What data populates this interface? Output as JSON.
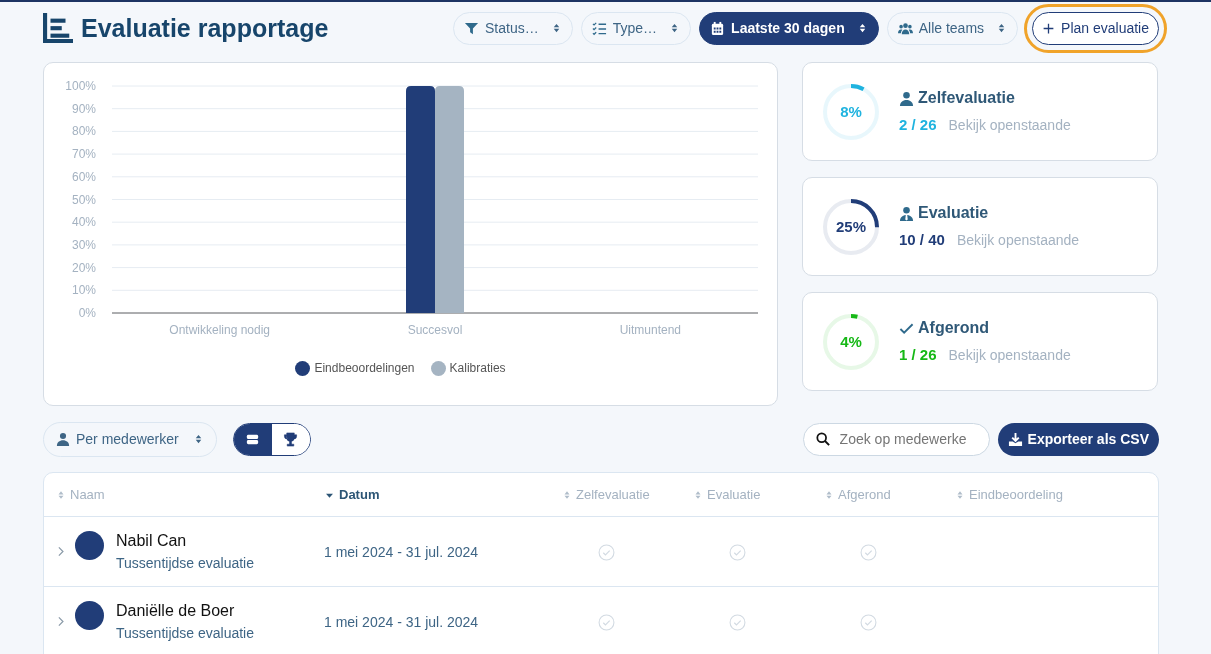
{
  "header": {
    "title": "Evaluatie rapportage",
    "filters": [
      {
        "label": "Status…",
        "selected": false
      },
      {
        "label": "Type…",
        "selected": false
      },
      {
        "label": "Laatste 30 dagen",
        "selected": true
      },
      {
        "label": "Alle teams",
        "selected": false
      }
    ],
    "plan_button": {
      "label": "Plan evaluatie",
      "highlighted": true
    }
  },
  "chart": {
    "chart_data": {
      "type": "bar",
      "categories": [
        "Ontwikkeling nodig",
        "Succesvol",
        "Uitmuntend"
      ],
      "series": [
        {
          "name": "Eindbeoordelingen",
          "color": "#213d78",
          "values": [
            0,
            100,
            0
          ]
        },
        {
          "name": "Kalibraties",
          "color": "#a5b4c2",
          "values": [
            0,
            100,
            0
          ]
        }
      ],
      "ylim": [
        0,
        100
      ],
      "grid": true,
      "legend": true,
      "yticks": [
        {
          "value": 0,
          "label": "0%"
        },
        {
          "value": 10,
          "label": "10%"
        },
        {
          "value": 20,
          "label": "20%"
        },
        {
          "value": 30,
          "label": "30%"
        },
        {
          "value": 40,
          "label": "40%"
        },
        {
          "value": 50,
          "label": "50%"
        },
        {
          "value": 60,
          "label": "60%"
        },
        {
          "value": 70,
          "label": "70%"
        },
        {
          "value": 80,
          "label": "80%"
        },
        {
          "value": 90,
          "label": "90%"
        },
        {
          "value": 100,
          "label": "100%"
        }
      ]
    }
  },
  "stats": [
    {
      "title": "Zelfevaluatie",
      "percent": "8%",
      "level": 0.08,
      "count": "2 / 26",
      "link": "Bekijk openstaande",
      "color": "#1fb3df"
    },
    {
      "title": "Evaluatie",
      "percent": "25%",
      "level": 0.25,
      "count": "10 / 40",
      "link": "Bekijk openstaande",
      "color": "#213d78"
    },
    {
      "title": "Afgerond",
      "percent": "4%",
      "level": 0.04,
      "count": "1 / 26",
      "link": "Bekijk openstaande",
      "color": "#16b816"
    }
  ],
  "toolbar": {
    "group_select": "Per medewerker",
    "views": [
      {
        "selected": true
      },
      {
        "selected": false
      }
    ],
    "search": {
      "placeholder": "Zoek op medewerke"
    },
    "export_button": "Exporteer als CSV"
  },
  "table": {
    "columns": [
      {
        "label": "Naam",
        "sorted": false
      },
      {
        "label": "Datum",
        "sorted": true
      },
      {
        "label": "Zelfevaluatie",
        "sorted": false
      },
      {
        "label": "Evaluatie",
        "sorted": false
      },
      {
        "label": "Afgerond",
        "sorted": false
      },
      {
        "label": "Eindbeoordeling",
        "sorted": false
      }
    ],
    "rows": [
      {
        "name": "Nabil Can",
        "type": "Tussentijdse evaluatie",
        "period": "1 mei 2024 - 31 jul. 2024"
      },
      {
        "name": "Daniëlle de Boer",
        "type": "Tussentijdse evaluatie",
        "period": "1 mei 2024 - 31 jul. 2024"
      }
    ]
  }
}
